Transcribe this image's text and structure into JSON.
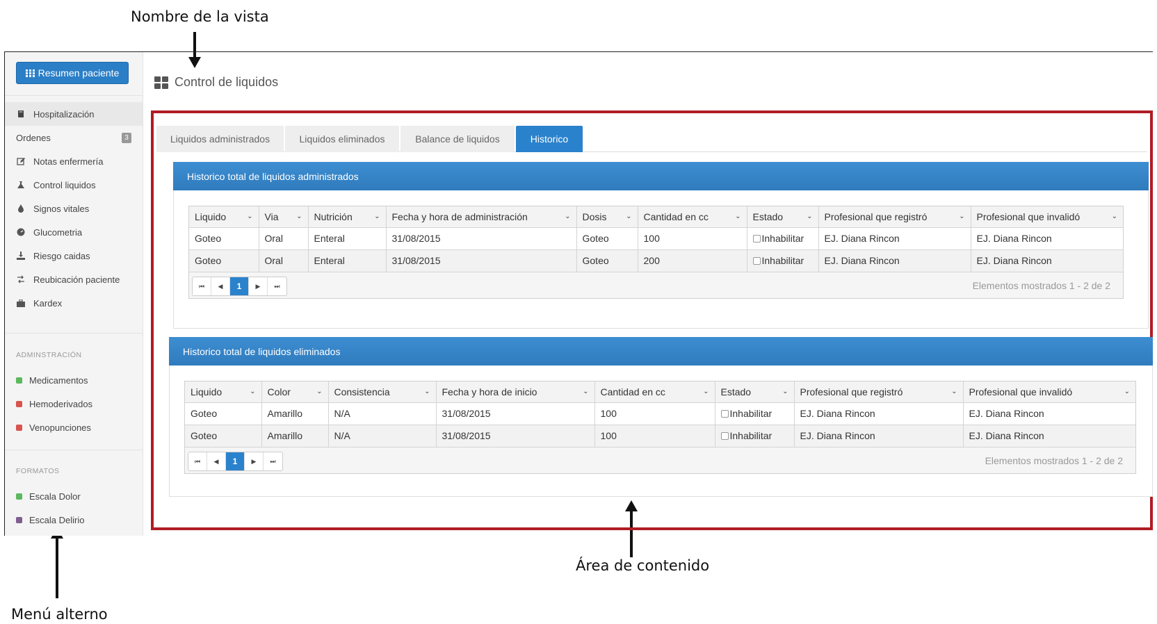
{
  "annotations": {
    "view_name": "Nombre de la vista",
    "content_area": "Área de contenido",
    "alt_menu": "Menú alterno"
  },
  "sidebar": {
    "primary_button": "Resumen paciente",
    "items": [
      {
        "label": "Hospitalización",
        "icon": "book-icon",
        "active": true
      },
      {
        "label": "Ordenes",
        "icon": "",
        "badge": "3"
      },
      {
        "label": "Notas enfermería",
        "icon": "edit-icon"
      },
      {
        "label": "Control liquidos",
        "icon": "flask-icon"
      },
      {
        "label": "Signos vitales",
        "icon": "drop-icon"
      },
      {
        "label": "Glucometria",
        "icon": "dashboard-icon"
      },
      {
        "label": "Riesgo caidas",
        "icon": "download-icon"
      },
      {
        "label": "Reubicación paciente",
        "icon": "transfer-icon"
      },
      {
        "label": "Kardex",
        "icon": "briefcase-icon"
      }
    ],
    "admin_header": "ADMINSTRACIÓN",
    "admin_items": [
      {
        "label": "Medicamentos",
        "color": "#5cb85c"
      },
      {
        "label": "Hemoderivados",
        "color": "#d9534f"
      },
      {
        "label": "Venopunciones",
        "color": "#d9534f"
      }
    ],
    "formats_header": "FORMATOS",
    "format_items": [
      {
        "label": "Escala Dolor",
        "color": "#5cb85c"
      },
      {
        "label": "Escala Delirio",
        "color": "#7e5d8f"
      }
    ]
  },
  "page": {
    "title": "Control de liquidos"
  },
  "tabs": [
    {
      "label": "Liquidos administrados"
    },
    {
      "label": "Liquidos eliminados"
    },
    {
      "label": "Balance de liquidos"
    },
    {
      "label": "Historico",
      "active": true
    }
  ],
  "panel_admin": {
    "title": "Historico total de liquidos administrados",
    "columns": [
      "Liquido",
      "Via",
      "Nutrición",
      "Fecha y hora de administración",
      "Dosis",
      "Cantidad en cc",
      "Estado",
      "Profesional que registró",
      "Profesional que invalidó"
    ],
    "rows": [
      [
        "Goteo",
        "Oral",
        "Enteral",
        "31/08/2015",
        "Goteo",
        "100",
        "Inhabilitar",
        "EJ. Diana Rincon",
        "EJ. Diana Rincon"
      ],
      [
        "Goteo",
        "Oral",
        "Enteral",
        "31/08/2015",
        "Goteo",
        "200",
        "Inhabilitar",
        "EJ. Diana Rincon",
        "EJ. Diana Rincon"
      ]
    ],
    "current_page": "1",
    "info": "Elementos mostrados 1 - 2 de 2"
  },
  "panel_elim": {
    "title": "Historico total de liquidos eliminados",
    "columns": [
      "Liquido",
      "Color",
      "Consistencia",
      "Fecha y hora de inicio",
      "Cantidad en cc",
      "Estado",
      "Profesional que registró",
      "Profesional que invalidó"
    ],
    "rows": [
      [
        "Goteo",
        "Amarillo",
        "N/A",
        "31/08/2015",
        "100",
        "Inhabilitar",
        "EJ. Diana Rincon",
        "EJ. Diana Rincon"
      ],
      [
        "Goteo",
        "Amarillo",
        "N/A",
        "31/08/2015",
        "100",
        "Inhabilitar",
        "EJ. Diana Rincon",
        "EJ. Diana Rincon"
      ]
    ],
    "current_page": "1",
    "info": "Elementos mostrados 1 - 2 de 2"
  }
}
